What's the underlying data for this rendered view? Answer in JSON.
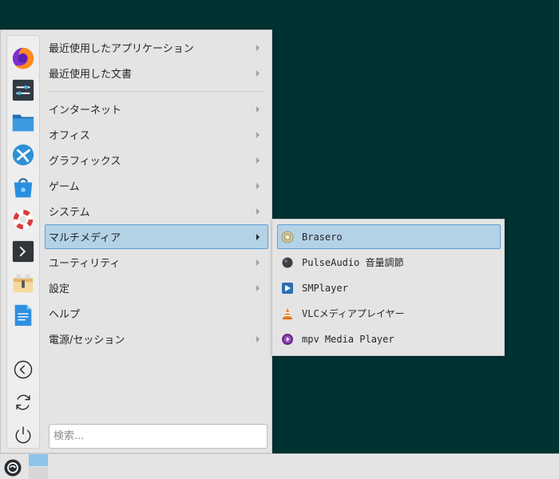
{
  "menu": {
    "favorites": [
      {
        "name": "firefox-icon"
      },
      {
        "name": "settings-icon"
      },
      {
        "name": "file-manager-icon"
      },
      {
        "name": "yast-icon"
      },
      {
        "name": "software-store-icon"
      },
      {
        "name": "help-lifebuoy-icon"
      },
      {
        "name": "terminal-icon"
      },
      {
        "name": "archive-icon"
      },
      {
        "name": "text-editor-icon"
      }
    ],
    "actions": [
      {
        "name": "logout-icon"
      },
      {
        "name": "restart-icon"
      },
      {
        "name": "power-icon"
      }
    ],
    "categories": [
      {
        "label": "最近使用したアプリケーション",
        "has_submenu": true
      },
      {
        "label": "最近使用した文書",
        "has_submenu": true
      },
      {
        "label": "インターネット",
        "has_submenu": true
      },
      {
        "label": "オフィス",
        "has_submenu": true
      },
      {
        "label": "グラフィックス",
        "has_submenu": true
      },
      {
        "label": "ゲーム",
        "has_submenu": true
      },
      {
        "label": "システム",
        "has_submenu": true
      },
      {
        "label": "マルチメディア",
        "has_submenu": true,
        "active": true
      },
      {
        "label": "ユーティリティ",
        "has_submenu": true
      },
      {
        "label": "設定",
        "has_submenu": true
      },
      {
        "label": "ヘルプ",
        "has_submenu": false
      },
      {
        "label": "電源/セッション",
        "has_submenu": true
      }
    ],
    "search": {
      "placeholder": "検索..."
    }
  },
  "submenu": {
    "items": [
      {
        "label": "Brasero",
        "icon": "brasero-icon",
        "active": true
      },
      {
        "label": "PulseAudio 音量調節",
        "icon": "pulseaudio-icon"
      },
      {
        "label": "SMPlayer",
        "icon": "smplayer-icon"
      },
      {
        "label": "VLCメディアプレイヤー",
        "icon": "vlc-icon"
      },
      {
        "label": "mpv Media Player",
        "icon": "mpv-icon"
      }
    ]
  },
  "colors": {
    "desktop": "#003232",
    "menu_bg": "#e4e4e4",
    "highlight": "#b4d2e6",
    "highlight_border": "#5fa0d8",
    "pager_active": "#8ec3ea"
  }
}
